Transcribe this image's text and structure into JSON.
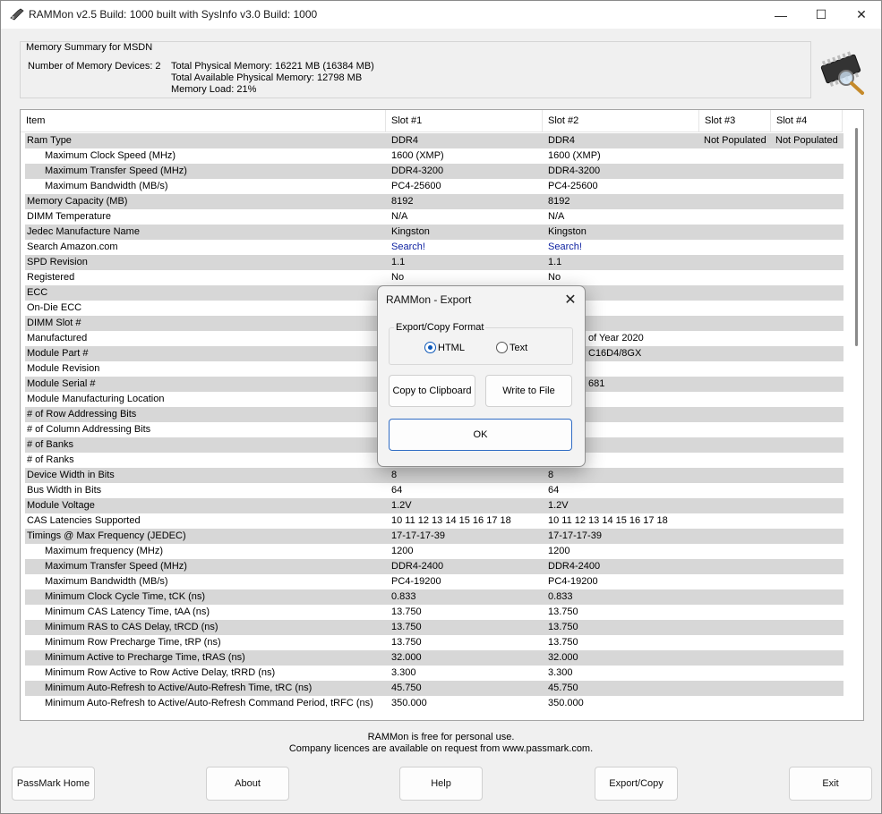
{
  "window": {
    "title": "RAMMon v2.5 Build: 1000 built with SysInfo v3.0 Build: 1000",
    "min_glyph": "—",
    "max_glyph": "☐",
    "close_glyph": "✕"
  },
  "summary": {
    "title": "Memory Summary for MSDN",
    "devices": "Number of Memory Devices: 2",
    "total_physical": "Total Physical Memory: 16221 MB (16384 MB)",
    "total_available": "Total Available Physical Memory: 12798 MB",
    "memory_load": "Memory Load: 21%"
  },
  "table": {
    "headers": [
      "Item",
      "Slot #1",
      "Slot #2",
      "Slot #3",
      "Slot #4"
    ],
    "rows": [
      {
        "item": "Ram Type",
        "indent": false,
        "s1": "DDR4",
        "s2": "DDR4",
        "s3": "Not Populated",
        "s4": "Not Populated"
      },
      {
        "item": "Maximum Clock Speed (MHz)",
        "indent": true,
        "s1": "1600 (XMP)",
        "s2": "1600 (XMP)",
        "s3": "",
        "s4": ""
      },
      {
        "item": "Maximum Transfer Speed (MHz)",
        "indent": true,
        "s1": "DDR4-3200",
        "s2": "DDR4-3200",
        "s3": "",
        "s4": ""
      },
      {
        "item": "Maximum Bandwidth (MB/s)",
        "indent": true,
        "s1": "PC4-25600",
        "s2": "PC4-25600",
        "s3": "",
        "s4": ""
      },
      {
        "item": "Memory Capacity (MB)",
        "indent": false,
        "s1": "8192",
        "s2": "8192",
        "s3": "",
        "s4": ""
      },
      {
        "item": "DIMM Temperature",
        "indent": false,
        "s1": "N/A",
        "s2": "N/A",
        "s3": "",
        "s4": ""
      },
      {
        "item": "Jedec Manufacture Name",
        "indent": false,
        "s1": "Kingston",
        "s2": "Kingston",
        "s3": "",
        "s4": ""
      },
      {
        "item": "Search Amazon.com",
        "indent": false,
        "s1": "Search!",
        "s2": "Search!",
        "s3": "",
        "s4": "",
        "link": true
      },
      {
        "item": "SPD Revision",
        "indent": false,
        "s1": "1.1",
        "s2": "1.1",
        "s3": "",
        "s4": ""
      },
      {
        "item": "Registered",
        "indent": false,
        "s1": "No",
        "s2": "No",
        "s3": "",
        "s4": ""
      },
      {
        "item": "ECC",
        "indent": false,
        "s1": "",
        "s2": "",
        "s3": "",
        "s4": ""
      },
      {
        "item": "On-Die ECC",
        "indent": false,
        "s1": "",
        "s2": "",
        "s3": "",
        "s4": ""
      },
      {
        "item": "DIMM Slot #",
        "indent": false,
        "s1": "",
        "s2": "",
        "s3": "",
        "s4": ""
      },
      {
        "item": "Manufactured",
        "indent": false,
        "s1": "",
        "s2": "of Year 2020",
        "s3": "",
        "s4": "",
        "s2_offset": true
      },
      {
        "item": "Module Part #",
        "indent": false,
        "s1": "",
        "s2": "C16D4/8GX",
        "s3": "",
        "s4": "",
        "s2_offset": true
      },
      {
        "item": "Module Revision",
        "indent": false,
        "s1": "",
        "s2": "",
        "s3": "",
        "s4": ""
      },
      {
        "item": "Module Serial #",
        "indent": false,
        "s1": "",
        "s2": "681",
        "s3": "",
        "s4": "",
        "s2_offset": true
      },
      {
        "item": "Module Manufacturing Location",
        "indent": false,
        "s1": "",
        "s2": "",
        "s3": "",
        "s4": ""
      },
      {
        "item": "# of Row Addressing Bits",
        "indent": false,
        "s1": "",
        "s2": "",
        "s3": "",
        "s4": ""
      },
      {
        "item": "# of Column Addressing Bits",
        "indent": false,
        "s1": "",
        "s2": "",
        "s3": "",
        "s4": ""
      },
      {
        "item": "# of Banks",
        "indent": false,
        "s1": "",
        "s2": "",
        "s3": "",
        "s4": ""
      },
      {
        "item": "# of Ranks",
        "indent": false,
        "s1": "",
        "s2": "",
        "s3": "",
        "s4": ""
      },
      {
        "item": "Device Width in Bits",
        "indent": false,
        "s1": "8",
        "s2": "8",
        "s3": "",
        "s4": ""
      },
      {
        "item": "Bus Width in Bits",
        "indent": false,
        "s1": "64",
        "s2": "64",
        "s3": "",
        "s4": ""
      },
      {
        "item": "Module Voltage",
        "indent": false,
        "s1": "1.2V",
        "s2": "1.2V",
        "s3": "",
        "s4": ""
      },
      {
        "item": "CAS Latencies Supported",
        "indent": false,
        "s1": "10 11 12 13 14 15 16 17 18",
        "s2": "10 11 12 13 14 15 16 17 18",
        "s3": "",
        "s4": ""
      },
      {
        "item": "Timings @ Max Frequency (JEDEC)",
        "indent": false,
        "s1": "17-17-17-39",
        "s2": "17-17-17-39",
        "s3": "",
        "s4": ""
      },
      {
        "item": "Maximum frequency (MHz)",
        "indent": true,
        "s1": "1200",
        "s2": "1200",
        "s3": "",
        "s4": ""
      },
      {
        "item": "Maximum Transfer Speed (MHz)",
        "indent": true,
        "s1": "DDR4-2400",
        "s2": "DDR4-2400",
        "s3": "",
        "s4": ""
      },
      {
        "item": "Maximum Bandwidth (MB/s)",
        "indent": true,
        "s1": "PC4-19200",
        "s2": "PC4-19200",
        "s3": "",
        "s4": ""
      },
      {
        "item": "Minimum Clock Cycle Time, tCK (ns)",
        "indent": true,
        "s1": "0.833",
        "s2": "0.833",
        "s3": "",
        "s4": ""
      },
      {
        "item": "Minimum CAS Latency Time, tAA (ns)",
        "indent": true,
        "s1": "13.750",
        "s2": "13.750",
        "s3": "",
        "s4": ""
      },
      {
        "item": "Minimum RAS to CAS Delay, tRCD (ns)",
        "indent": true,
        "s1": "13.750",
        "s2": "13.750",
        "s3": "",
        "s4": ""
      },
      {
        "item": "Minimum Row Precharge Time, tRP (ns)",
        "indent": true,
        "s1": "13.750",
        "s2": "13.750",
        "s3": "",
        "s4": ""
      },
      {
        "item": "Minimum Active to Precharge Time, tRAS (ns)",
        "indent": true,
        "s1": "32.000",
        "s2": "32.000",
        "s3": "",
        "s4": ""
      },
      {
        "item": "Minimum Row Active to Row Active Delay, tRRD (ns)",
        "indent": true,
        "s1": "3.300",
        "s2": "3.300",
        "s3": "",
        "s4": ""
      },
      {
        "item": "Minimum Auto-Refresh to Active/Auto-Refresh Time, tRC (ns)",
        "indent": true,
        "s1": "45.750",
        "s2": "45.750",
        "s3": "",
        "s4": ""
      },
      {
        "item": "Minimum Auto-Refresh to Active/Auto-Refresh Command Period, tRFC (ns)",
        "indent": true,
        "s1": "350.000",
        "s2": "350.000",
        "s3": "",
        "s4": ""
      }
    ]
  },
  "footer": {
    "line1": "RAMMon is free for personal use.",
    "line2": "Company licences are available on request from www.passmark.com."
  },
  "buttons": {
    "passmark_home": "PassMark Home",
    "about": "About",
    "help": "Help",
    "export_copy": "Export/Copy",
    "exit": "Exit"
  },
  "dialog": {
    "title": "RAMMon - Export",
    "close_glyph": "✕",
    "group_label": "Export/Copy Format",
    "radio_html": "HTML",
    "radio_text": "Text",
    "selected": "HTML",
    "copy_to_clipboard": "Copy to Clipboard",
    "write_to_file": "Write to File",
    "ok": "OK"
  },
  "colors": {
    "alt_row": "#d7d7d7",
    "link": "#0b1fa0",
    "radio_accent": "#0b57b8"
  }
}
